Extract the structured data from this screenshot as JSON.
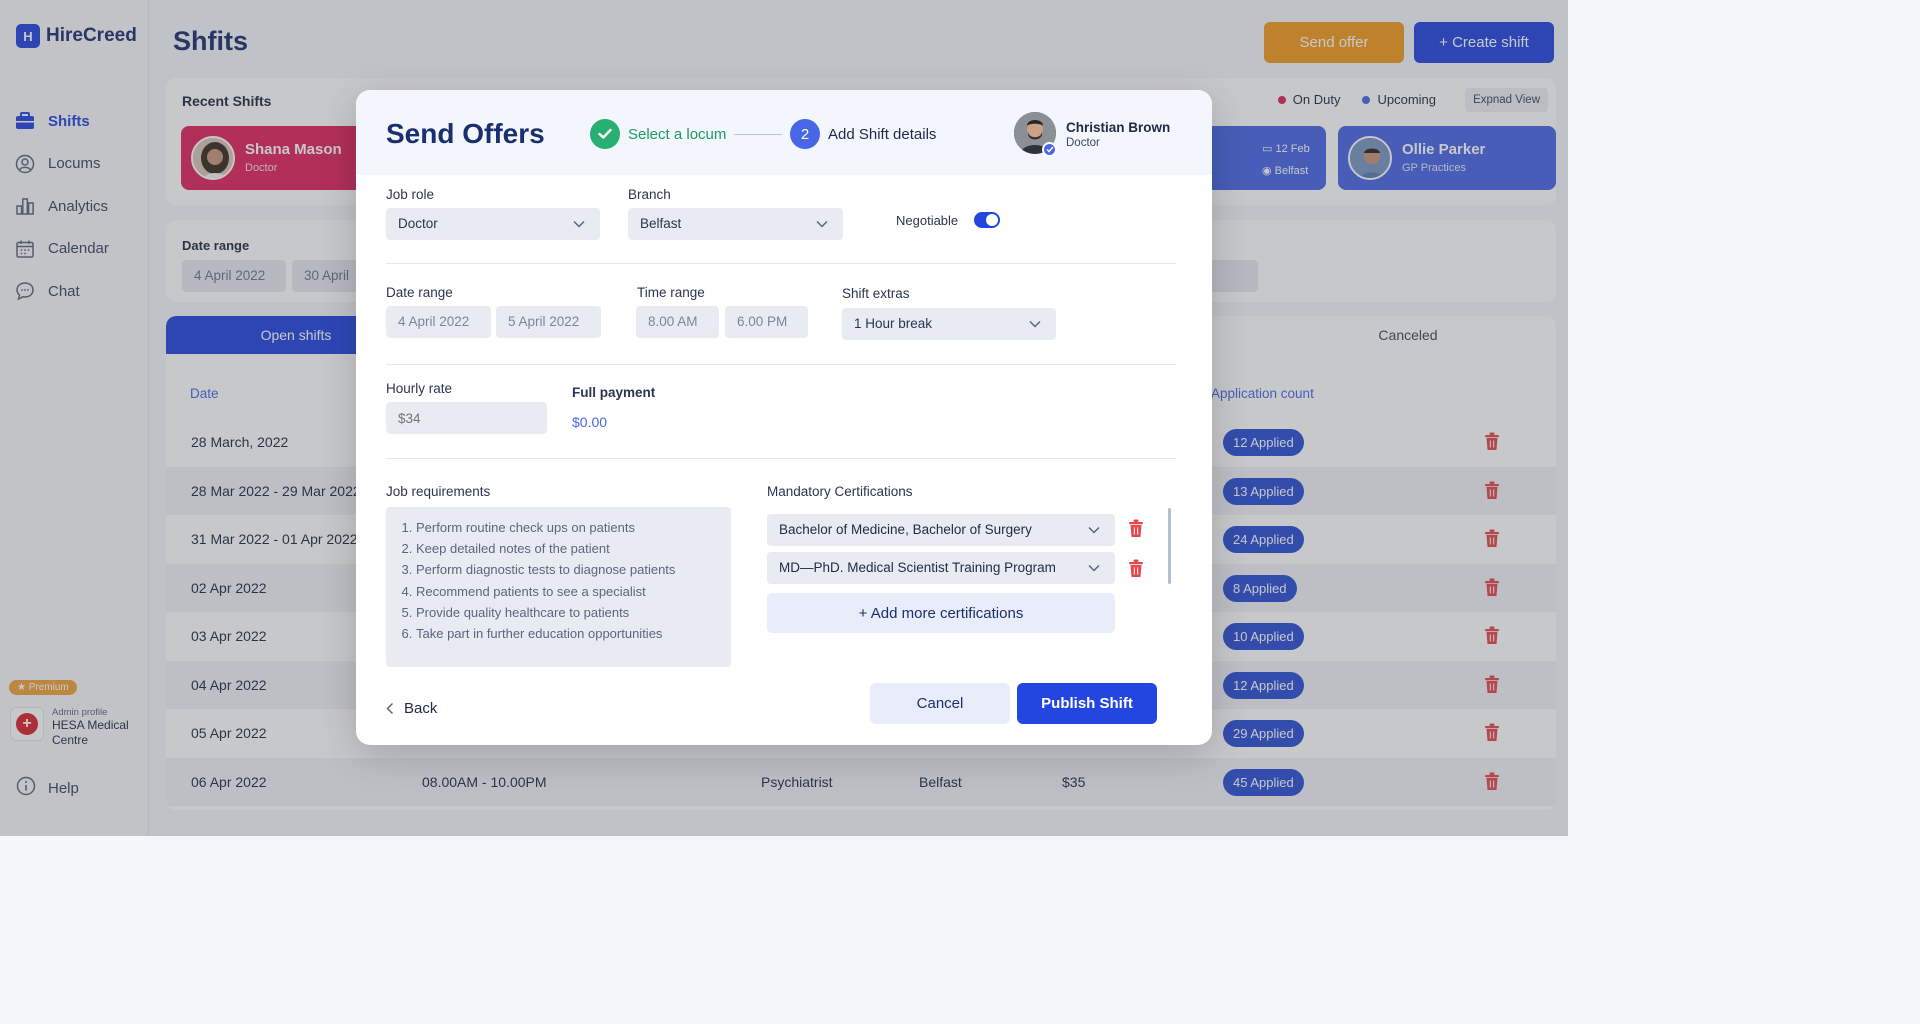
{
  "app": {
    "logo_text": "HireCreed",
    "logo_mark": "H",
    "page_title": "Shfits"
  },
  "sidebar": {
    "items": [
      {
        "label": "Shifts",
        "icon": "briefcase-icon"
      },
      {
        "label": "Locums",
        "icon": "user-circle-icon"
      },
      {
        "label": "Analytics",
        "icon": "bar-chart-icon"
      },
      {
        "label": "Calendar",
        "icon": "calendar-icon"
      },
      {
        "label": "Chat",
        "icon": "chat-icon"
      }
    ],
    "premium_badge": "Premium",
    "admin_caption": "Admin profile",
    "admin_name": "HESA Medical Centre",
    "help_label": "Help"
  },
  "header": {
    "send_offer_label": "Send offer",
    "create_shift_label": "+ Create shift"
  },
  "recent": {
    "title": "Recent Shifts",
    "legend_on_duty": "On Duty",
    "legend_upcoming": "Upcoming",
    "expand_label": "Expnad View",
    "cards": [
      {
        "name": "Shana Mason",
        "role": "Doctor"
      },
      {
        "date": "12 Feb",
        "location": "Belfast"
      },
      {
        "name": "Ollie Parker",
        "role": "GP Practices"
      }
    ]
  },
  "filters": {
    "date_range_label": "Date range",
    "start": "4 April 2022",
    "end": "30 April"
  },
  "table": {
    "tab_open": "Open shifts",
    "tab_canceled": "Canceled",
    "col_date": "Date",
    "col_applications": "Application count",
    "rows": [
      {
        "date": "28 March, 2022",
        "applied": "12 Applied"
      },
      {
        "date": "28 Mar 2022 - 29 Mar 2022",
        "applied": "13 Applied"
      },
      {
        "date": "31 Mar 2022 - 01 Apr 2022",
        "applied": "24 Applied"
      },
      {
        "date": "02 Apr 2022",
        "applied": "8 Applied"
      },
      {
        "date": "03 Apr 2022",
        "applied": "10 Applied"
      },
      {
        "date": "04 Apr 2022",
        "applied": "12 Applied"
      },
      {
        "date": "05 Apr 2022",
        "applied": "29 Applied"
      },
      {
        "date": "06 Apr 2022",
        "time": "08.00AM - 10.00PM",
        "role": "Psychiatrist",
        "branch": "Belfast",
        "rate": "$35",
        "applied": "45 Applied"
      }
    ]
  },
  "modal": {
    "title": "Send Offers",
    "step1_label": "Select a locum",
    "step2_number": "2",
    "step2_label": "Add Shift details",
    "locum_name": "Christian Brown",
    "locum_role": "Doctor",
    "job_role_label": "Job role",
    "job_role_value": "Doctor",
    "branch_label": "Branch",
    "branch_value": "Belfast",
    "negotiable_label": "Negotiable",
    "date_range_label": "Date range",
    "date_start": "4 April 2022",
    "date_end": "5 April 2022",
    "time_range_label": "Time range",
    "time_start": "8.00  AM",
    "time_end": "6.00  PM",
    "shift_extras_label": "Shift extras",
    "shift_extras_value": "1 Hour break",
    "hourly_rate_label": "Hourly rate",
    "hourly_rate_placeholder": "$34",
    "full_payment_label": "Full payment",
    "full_payment_value": "$0.00",
    "requirements_label": "Job requirements",
    "requirements": [
      "Perform routine check ups on patients",
      "Keep detailed notes of the patient",
      "Perform diagnostic tests to diagnose patients",
      "Recommend patients to see a specialist",
      "Provide quality healthcare to patients",
      "Take part in further education opportunities"
    ],
    "certs_label": "Mandatory Certifications",
    "certs": [
      "Bachelor of Medicine, Bachelor of Surgery",
      "MD—PhD. Medical Scientist Training Program"
    ],
    "add_cert_label": "+ Add more certifications",
    "back_label": "Back",
    "cancel_label": "Cancel",
    "publish_label": "Publish Shift"
  },
  "colors": {
    "primary": "#2346e0",
    "accent_orange": "#f39a1e",
    "success": "#27b071",
    "danger": "#e5484d",
    "on_duty": "#e0245e",
    "upcoming": "#4866e6"
  }
}
